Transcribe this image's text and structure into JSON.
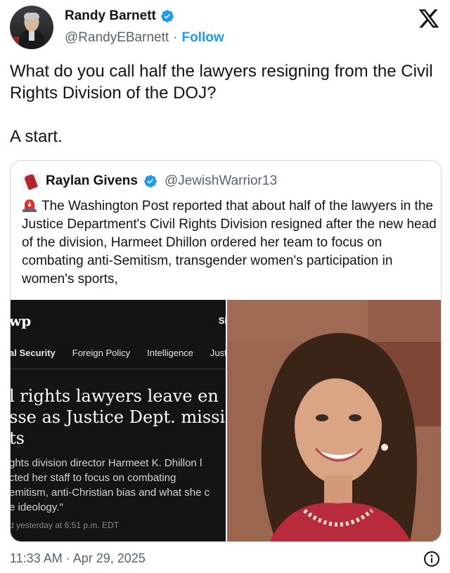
{
  "author": {
    "name": "Randy Barnett",
    "handle": "@RandyEBarnett",
    "separator": "·",
    "follow_label": "Follow",
    "avatar_icon": "author-avatar"
  },
  "tweet": {
    "line1": "What do you call half the lawyers resigning from the Civil Rights Division of the DOJ?",
    "line2": "A start."
  },
  "quote": {
    "name": "Raylan Givens",
    "handle": "@JewishWarrior13",
    "icon": "siren-icon",
    "text": "The Washington Post reported that about half of the lawyers in the Justice Department's Civil Rights Division resigned after the new head of the division, Harmeet Dhillon ordered her team to focus on combating anti-Semitism, transgender women's participation in women's sports,"
  },
  "media": {
    "wp_logo": "wp",
    "wp_section": "Si",
    "wp_nav": [
      "al Security",
      "Foreign Policy",
      "Intelligence",
      "Just"
    ],
    "wp_headline": [
      "l rights lawyers leave en",
      "sse as Justice Dept. mission",
      "ts"
    ],
    "wp_sub": [
      "ghts division director Harmeet K. Dhillon l",
      "cted her staff to focus on combating",
      "emitism, anti-Christian bias and what she c",
      "e ideology.\""
    ],
    "wp_date": "d yesterday at 6:51 p.m. EDT"
  },
  "footer": {
    "timestamp": "11:33 AM · Apr 29, 2025"
  },
  "colors": {
    "accent": "#1d9bf0",
    "secondary_text": "#536471",
    "border": "#cfd9de"
  }
}
